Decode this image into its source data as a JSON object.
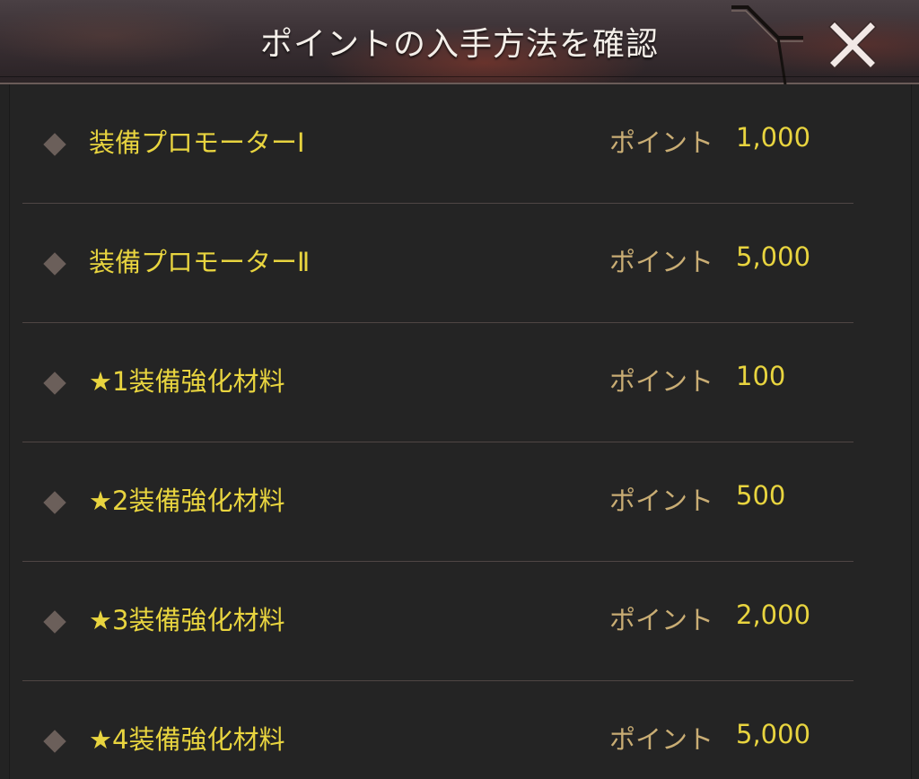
{
  "dialog": {
    "title": "ポイントの入手方法を確認",
    "close_icon": "close-x-icon"
  },
  "items": [
    {
      "name": "装備プロモーターⅠ",
      "points_label": "ポイント",
      "points": "1,000"
    },
    {
      "name": "装備プロモーターⅡ",
      "points_label": "ポイント",
      "points": "5,000"
    },
    {
      "name": "★1装備強化材料",
      "points_label": "ポイント",
      "points": "100"
    },
    {
      "name": "★2装備強化材料",
      "points_label": "ポイント",
      "points": "500"
    },
    {
      "name": "★3装備強化材料",
      "points_label": "ポイント",
      "points": "2,000"
    },
    {
      "name": "★4装備強化材料",
      "points_label": "ポイント",
      "points": "5,000"
    }
  ],
  "colors": {
    "item_text": "#e8d43f",
    "label_text": "#c9ad74",
    "title_text": "#f4efe9",
    "panel_bg": "#242424",
    "divider": "#4f4644"
  }
}
